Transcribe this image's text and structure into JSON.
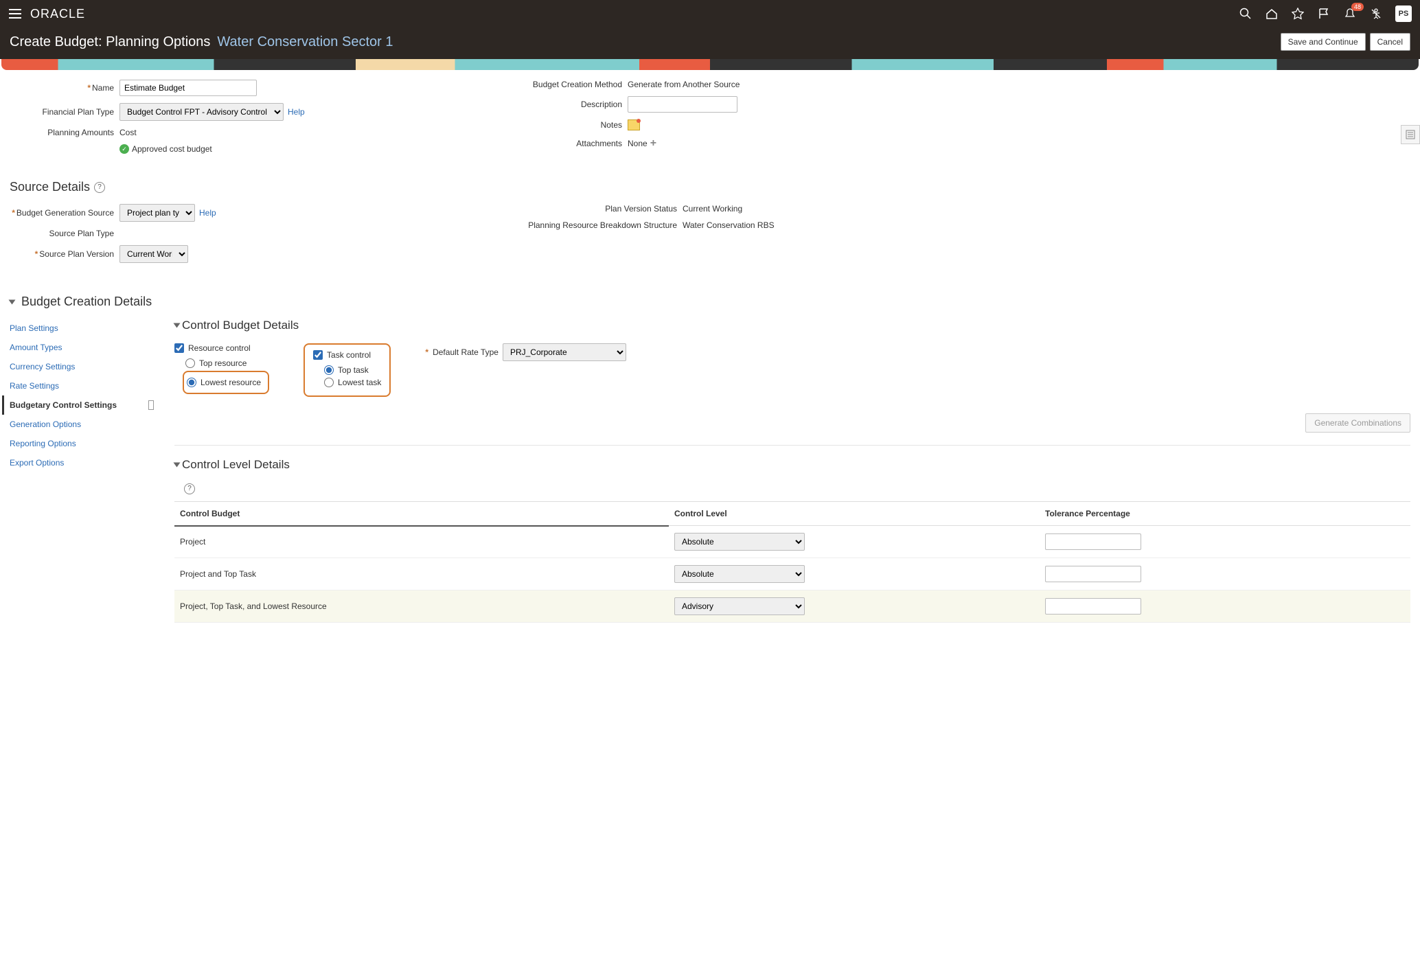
{
  "header": {
    "brand": "ORACLE",
    "badge": "48",
    "user": "PS"
  },
  "subheader": {
    "title": "Create Budget: Planning Options",
    "subtitle": "Water Conservation Sector 1",
    "save": "Save and Continue",
    "cancel": "Cancel"
  },
  "basic": {
    "labels": {
      "name": "Name",
      "fpt": "Financial Plan Type",
      "planning_amounts": "Planning Amounts",
      "bcm": "Budget Creation Method",
      "description": "Description",
      "notes": "Notes",
      "attachments": "Attachments"
    },
    "name_value": "Estimate Budget",
    "fpt_value": "Budget Control FPT - Advisory Control",
    "planning_amounts_value": "Cost",
    "approved_text": "Approved cost budget",
    "bcm_value": "Generate from Another Source",
    "attachments_value": "None",
    "help": "Help"
  },
  "source_details": {
    "title": "Source Details",
    "labels": {
      "bgs": "Budget Generation Source",
      "spt": "Source Plan Type",
      "spv": "Source Plan Version",
      "pvs": "Plan Version Status",
      "prbs": "Planning Resource Breakdown Structure"
    },
    "bgs_value": "Project plan type",
    "spv_value": "Current Working",
    "pvs_value": "Current Working",
    "prbs_value": "Water Conservation RBS",
    "help": "Help"
  },
  "creation_details": {
    "title": "Budget Creation Details",
    "nav": [
      "Plan Settings",
      "Amount Types",
      "Currency Settings",
      "Rate Settings",
      "Budgetary Control Settings",
      "Generation Options",
      "Reporting Options",
      "Export Options"
    ],
    "active_index": 4
  },
  "control_budget": {
    "title": "Control Budget Details",
    "resource_control": "Resource control",
    "top_resource": "Top resource",
    "lowest_resource": "Lowest resource",
    "task_control": "Task control",
    "top_task": "Top task",
    "lowest_task": "Lowest task",
    "default_rate_type": "Default Rate Type",
    "rate_value": "PRJ_Corporate",
    "generate": "Generate Combinations"
  },
  "control_level": {
    "title": "Control Level Details",
    "headers": {
      "cb": "Control Budget",
      "cl": "Control Level",
      "tp": "Tolerance Percentage"
    },
    "rows": [
      {
        "name": "Project",
        "level": "Absolute",
        "tolerance": ""
      },
      {
        "name": "Project and Top Task",
        "level": "Absolute",
        "tolerance": ""
      },
      {
        "name": "Project, Top Task, and Lowest Resource",
        "level": "Advisory",
        "tolerance": ""
      }
    ]
  }
}
